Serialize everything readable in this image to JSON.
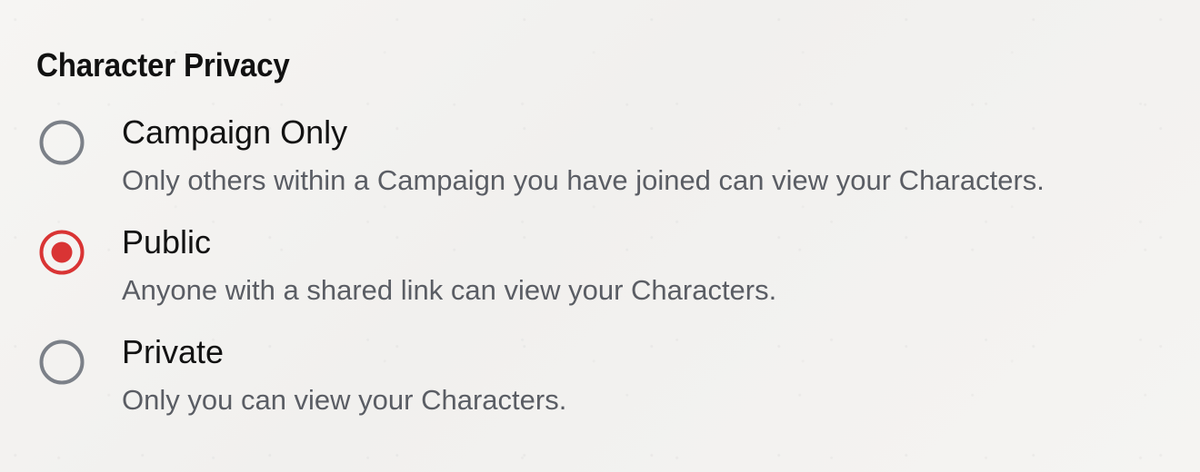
{
  "privacy": {
    "title": "Character Privacy",
    "selected": "public",
    "options": [
      {
        "id": "campaign_only",
        "label": "Campaign Only",
        "description": "Only others within a Campaign you have joined can view your Characters.",
        "checked": false
      },
      {
        "id": "public",
        "label": "Public",
        "description": "Anyone with a shared link can view your Characters.",
        "checked": true
      },
      {
        "id": "private",
        "label": "Private",
        "description": "Only you can view your Characters.",
        "checked": false
      }
    ]
  },
  "colors": {
    "radio_unchecked": "#7b8088",
    "radio_checked": "#d93434",
    "description_text": "#5a5d64"
  },
  "icons": {
    "unchecked": "radio-unchecked-icon",
    "checked": "radio-checked-icon"
  }
}
